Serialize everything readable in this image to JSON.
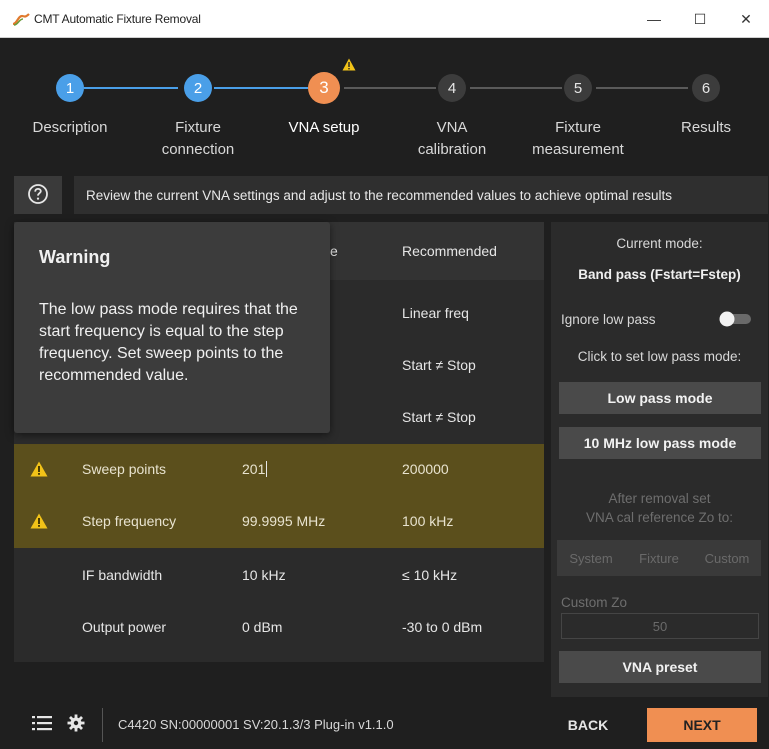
{
  "window": {
    "title": "CMT Automatic Fixture Removal",
    "controls": {
      "minimize": "—",
      "maximize": "☐",
      "close": "✕"
    }
  },
  "steps": [
    {
      "number": "1",
      "label": "Description",
      "state": "done"
    },
    {
      "number": "2",
      "label": "Fixture\nconnection",
      "state": "done"
    },
    {
      "number": "3",
      "label": "VNA setup",
      "state": "active-warning"
    },
    {
      "number": "4",
      "label": "VNA\ncalibration",
      "state": "pending"
    },
    {
      "number": "5",
      "label": "Fixture\nmeasurement",
      "state": "pending"
    },
    {
      "number": "6",
      "label": "Results",
      "state": "pending"
    }
  ],
  "info_bar": {
    "text": "Review the current VNA settings and adjust to the recommended values to achieve optimal results"
  },
  "table": {
    "header_partial": "e",
    "header_recommended": "Recommended",
    "hidden_rows_recommended": [
      "Linear freq",
      "Start ≠ Stop",
      "Start ≠ Stop"
    ],
    "rows": [
      {
        "setting": "Sweep points",
        "current": "201",
        "recommended": "200000",
        "warning": true
      },
      {
        "setting": "Step frequency",
        "current": "99.9995 MHz",
        "recommended": "100 kHz",
        "warning": true
      },
      {
        "setting": "IF bandwidth",
        "current": "10 kHz",
        "recommended": "≤ 10 kHz",
        "warning": false
      },
      {
        "setting": "Output power",
        "current": "0 dBm",
        "recommended": "-30 to 0 dBm",
        "warning": false
      }
    ]
  },
  "tooltip": {
    "title": "Warning",
    "body": "The low pass mode requires that the start frequency is equal to the step frequency. Set sweep points to the recommended value."
  },
  "right_panel": {
    "current_mode_label": "Current mode:",
    "current_mode_value": "Band pass (Fstart=Fstep)",
    "ignore_low_pass": "Ignore low pass",
    "click_to_set": "Click to set low pass mode:",
    "low_pass_button": "Low pass mode",
    "low_pass_10mhz_button": "10 MHz low pass mode",
    "after_removal_line1": "After removal set",
    "after_removal_line2": "VNA cal reference Zo to:",
    "zo_options": [
      "System",
      "Fixture",
      "Custom"
    ],
    "custom_zo_label": "Custom Zo",
    "custom_zo_value": "50",
    "vna_preset_button": "VNA preset"
  },
  "footer": {
    "device_info": "C4420 SN:00000001 SV:20.1.3/3 Plug-in v1.1.0",
    "back_label": "BACK",
    "next_label": "NEXT"
  },
  "colors": {
    "step_done": "#4a9fe8",
    "step_active": "#f08f52",
    "step_pending": "#3c3c3c",
    "warning_row": "#5b4f1c",
    "warning_icon": "#f2c318",
    "next_button": "#f08f52"
  }
}
